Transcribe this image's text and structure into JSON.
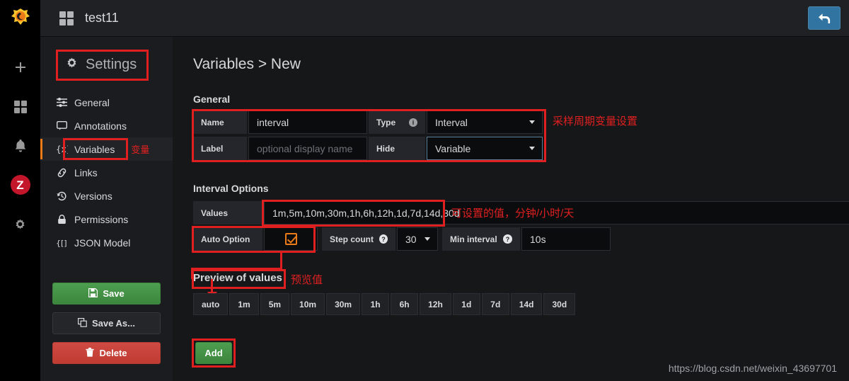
{
  "topbar": {
    "dashboard_icon": "dashboard-grid-icon",
    "title": "test11",
    "back_icon": "back-arrow-icon"
  },
  "rail": {
    "logo": "grafana-logo-icon",
    "items": [
      {
        "name": "create-icon",
        "glyph": "+"
      },
      {
        "name": "dashboards-icon",
        "glyph": "grid"
      },
      {
        "name": "alerting-bell-icon",
        "glyph": "bell"
      },
      {
        "name": "user-avatar",
        "glyph": "Z"
      },
      {
        "name": "configuration-gear-icon",
        "glyph": "gear"
      }
    ]
  },
  "settings": {
    "header": "Settings",
    "header_icon": "gear-icon",
    "nav": [
      {
        "label": "General",
        "icon": "sliders-icon"
      },
      {
        "label": "Annotations",
        "icon": "comment-icon"
      },
      {
        "label": "Variables",
        "icon": "variable-braces-icon",
        "note": "变量"
      },
      {
        "label": "Links",
        "icon": "link-icon"
      },
      {
        "label": "Versions",
        "icon": "history-icon"
      },
      {
        "label": "Permissions",
        "icon": "lock-icon"
      },
      {
        "label": "JSON Model",
        "icon": "json-braces-icon"
      }
    ],
    "buttons": {
      "save": "Save",
      "save_icon": "floppy-disk-icon",
      "save_as": "Save As...",
      "save_as_icon": "copy-icon",
      "delete": "Delete",
      "delete_icon": "trash-icon"
    }
  },
  "page": {
    "title": "Variables > New",
    "general": {
      "section": "General",
      "name_label": "Name",
      "name_value": "interval",
      "label_label": "Label",
      "label_placeholder": "optional display name",
      "type_label": "Type",
      "type_value": "Interval",
      "hide_label": "Hide",
      "hide_value": "Variable",
      "annotation": "采样周期变量设置"
    },
    "interval_options": {
      "section": "Interval Options",
      "values_label": "Values",
      "values_value": "1m,5m,10m,30m,1h,6h,12h,1d,7d,14d,30d",
      "values_annotation": "可设置的值，分钟/小时/天",
      "auto_option_label": "Auto Option",
      "auto_option_checked": "checked",
      "step_count_label": "Step count",
      "step_count_value": "30",
      "min_interval_label": "Min interval",
      "min_interval_value": "10s"
    },
    "preview": {
      "label": "Preview of values",
      "annotation": "预览值",
      "chips": [
        "auto",
        "1m",
        "5m",
        "10m",
        "30m",
        "1h",
        "6h",
        "12h",
        "1d",
        "7d",
        "14d",
        "30d"
      ]
    },
    "add_button": "Add",
    "footer_url": "https://blog.csdn.net/weixin_43697701"
  },
  "colors": {
    "accent_orange": "#eb7b18",
    "annotation_red": "#e02020",
    "save_green": "#3c863e",
    "delete_red": "#bf3c33",
    "avatar_red": "#c4162a",
    "back_blue": "#3274a1"
  }
}
